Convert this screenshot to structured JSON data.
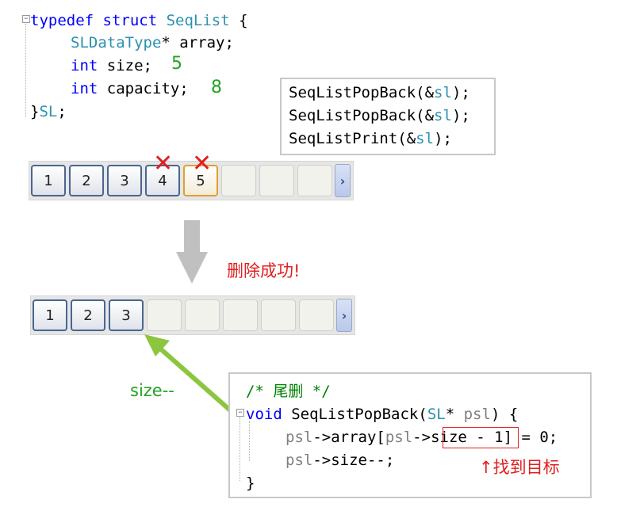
{
  "struct_code": {
    "l1_kw": "typedef struct",
    "l1_name": "SeqList",
    "l1_brace": "{",
    "l2_type": "SLDataType",
    "l2_rest": "* array;",
    "l3_kw": "int",
    "l3_rest": "size;",
    "l4_kw": "int",
    "l4_rest": "capacity;",
    "l5_close": "}",
    "l5_name": "SL",
    "l5_semi": ";"
  },
  "annotations": {
    "size_value": "5",
    "capacity_value": "8",
    "size_decrement": "size--"
  },
  "calls_box": {
    "lines": [
      {
        "fn": "SeqListPopBack",
        "open": "(&",
        "arg": "sl",
        "close": ");"
      },
      {
        "fn": "SeqListPopBack",
        "open": "(&",
        "arg": "sl",
        "close": ");"
      },
      {
        "fn": "SeqListPrint",
        "open": "(&",
        "arg": "sl",
        "close": ");"
      }
    ]
  },
  "array_before": {
    "cells": [
      "1",
      "2",
      "3",
      "4",
      "5",
      "",
      "",
      ""
    ],
    "deleted_marks": [
      "✕",
      "✕"
    ]
  },
  "array_after": {
    "cells": [
      "1",
      "2",
      "3",
      "",
      "",
      "",
      "",
      ""
    ]
  },
  "scroll_icon": "›",
  "success_message": "删除成功!",
  "popback_code": {
    "comment": "/* 尾删 */",
    "sig_kw": "void",
    "sig_fn": "SeqListPopBack(",
    "sig_type": "SL",
    "sig_ptr": "*",
    "sig_param": "psl",
    "sig_end": ") {",
    "line2_a": "psl",
    "line2_b": "->array[",
    "line2_c": "psl",
    "line2_d": "->",
    "line2_e": "size - 1",
    "line2_f": "] = 0;",
    "line3_a": "psl",
    "line3_b": "->size--;",
    "close": "}"
  },
  "target_note": "↑找到目标",
  "colors": {
    "keyword": "#0000ff",
    "type": "#2b91af",
    "annotation_green": "#22a322",
    "alert_red": "#e02020",
    "arrow_gray": "#c0c0c0",
    "arrow_green": "#8cc63f"
  }
}
